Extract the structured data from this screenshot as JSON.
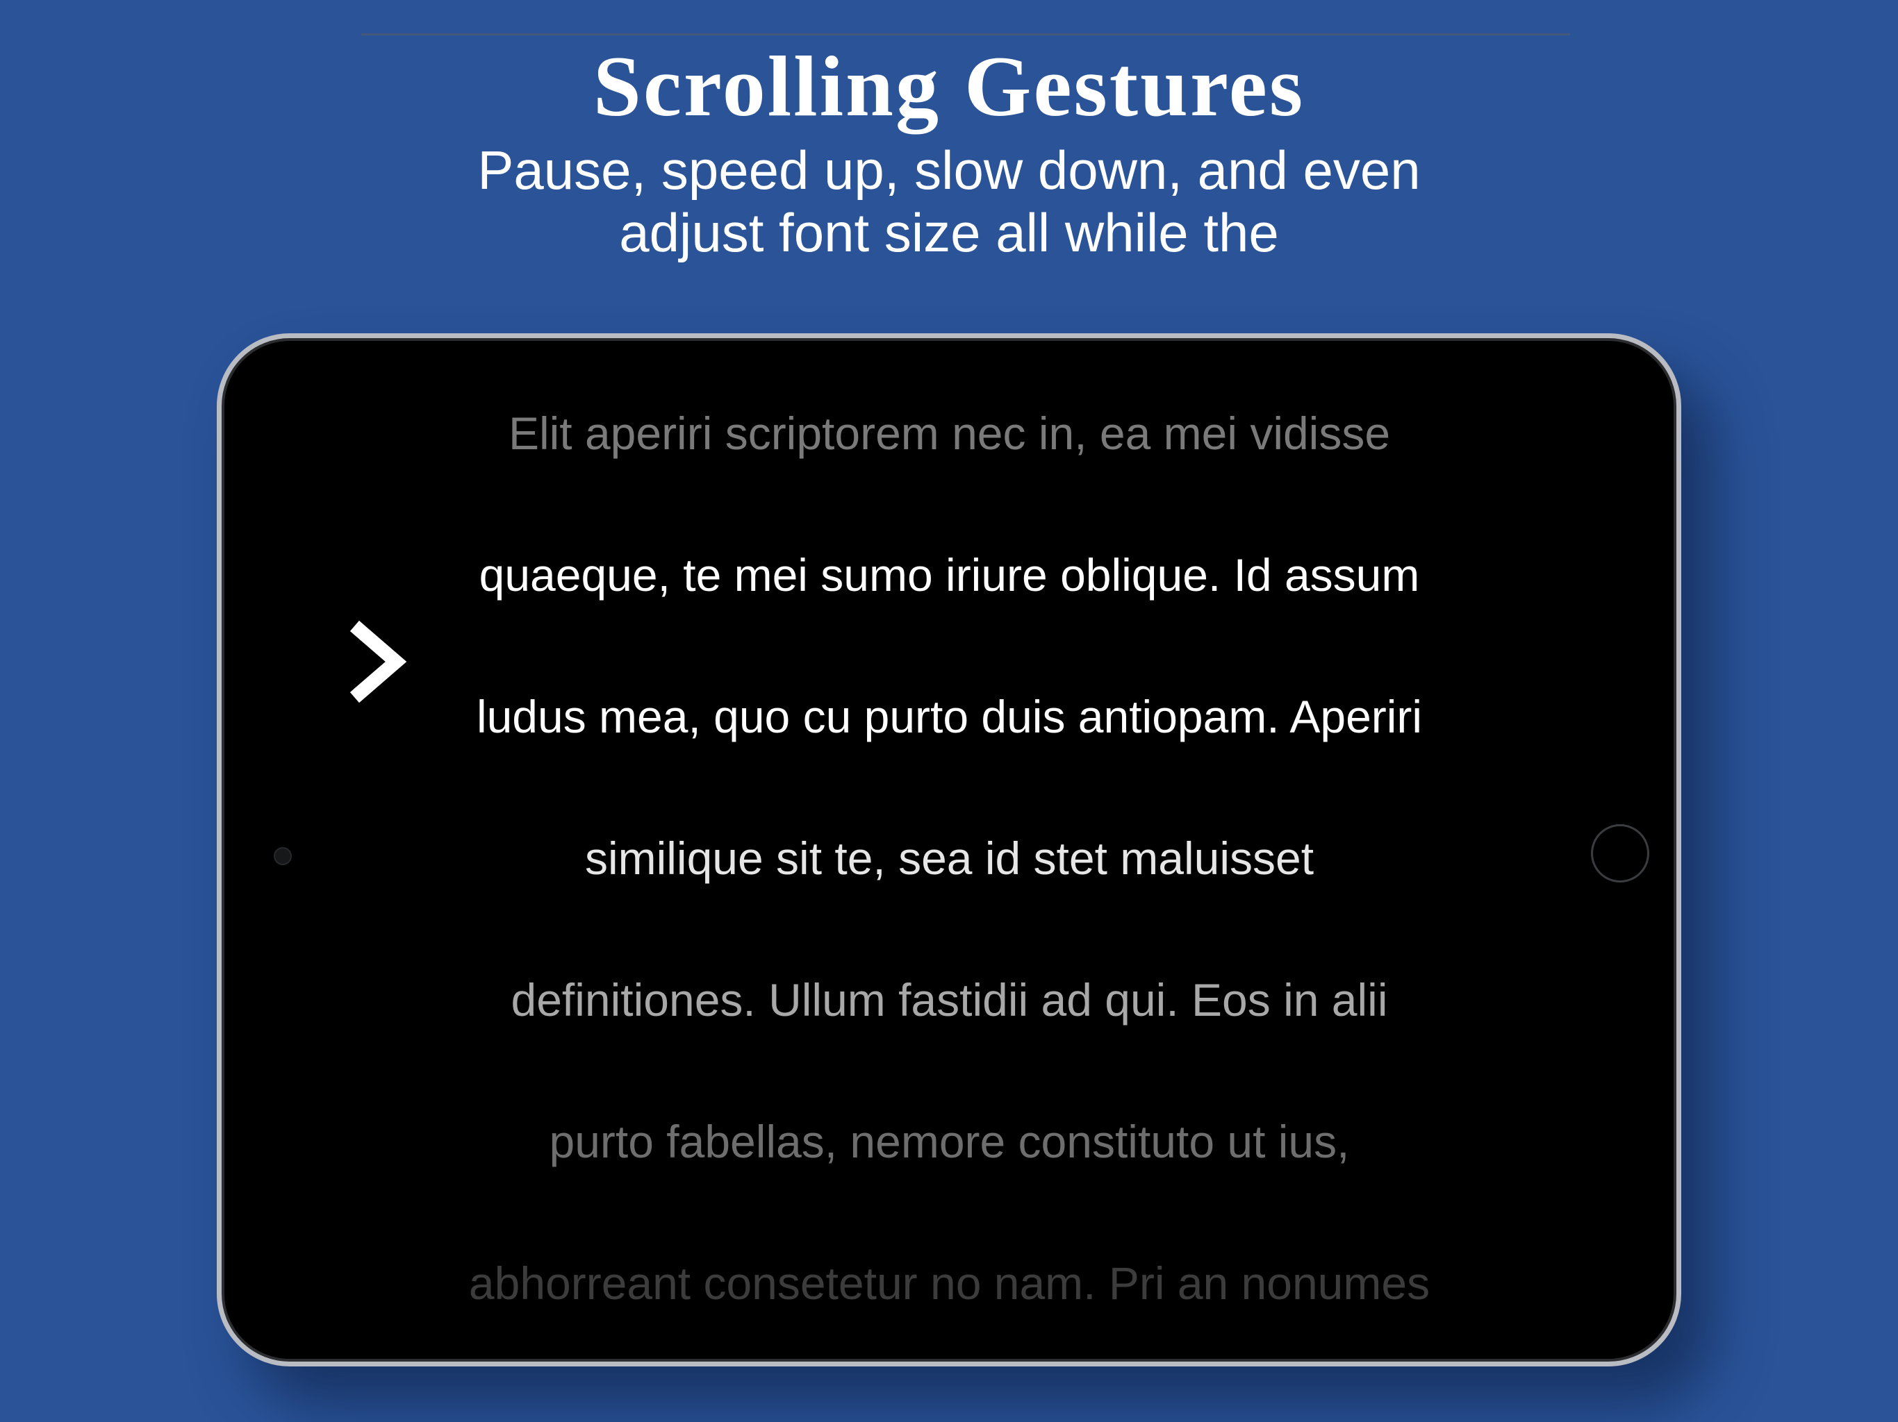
{
  "header": {
    "title": "Scrolling Gestures",
    "subtitle_line1": "Pause, speed up, slow down, and even",
    "subtitle_line2": "adjust font size all while the"
  },
  "device": {
    "icons": {
      "camera": "camera-dot-icon",
      "home": "home-button-icon",
      "indicator": "chevron-right-icon"
    }
  },
  "teleprompter": {
    "lines": [
      {
        "text": "Elit aperiri scriptorem nec in, ea mei vidisse",
        "color": "#7a7a7a"
      },
      {
        "text": "quaeque, te mei sumo iriure oblique. Id assum",
        "color": "#ffffff"
      },
      {
        "text": "ludus mea, quo cu purto duis antiopam. Aperiri",
        "color": "#ffffff"
      },
      {
        "text": "similique sit te, sea id stet maluisset",
        "color": "#e6e6e6"
      },
      {
        "text": "definitiones. Ullum fastidii ad qui. Eos in alii",
        "color": "#a8a8a8"
      },
      {
        "text": "purto fabellas, nemore constituto ut ius,",
        "color": "#6e6e6e"
      },
      {
        "text": "abhorreant consetetur no nam. Pri an nonumes",
        "color": "#3c3c3c"
      }
    ]
  }
}
